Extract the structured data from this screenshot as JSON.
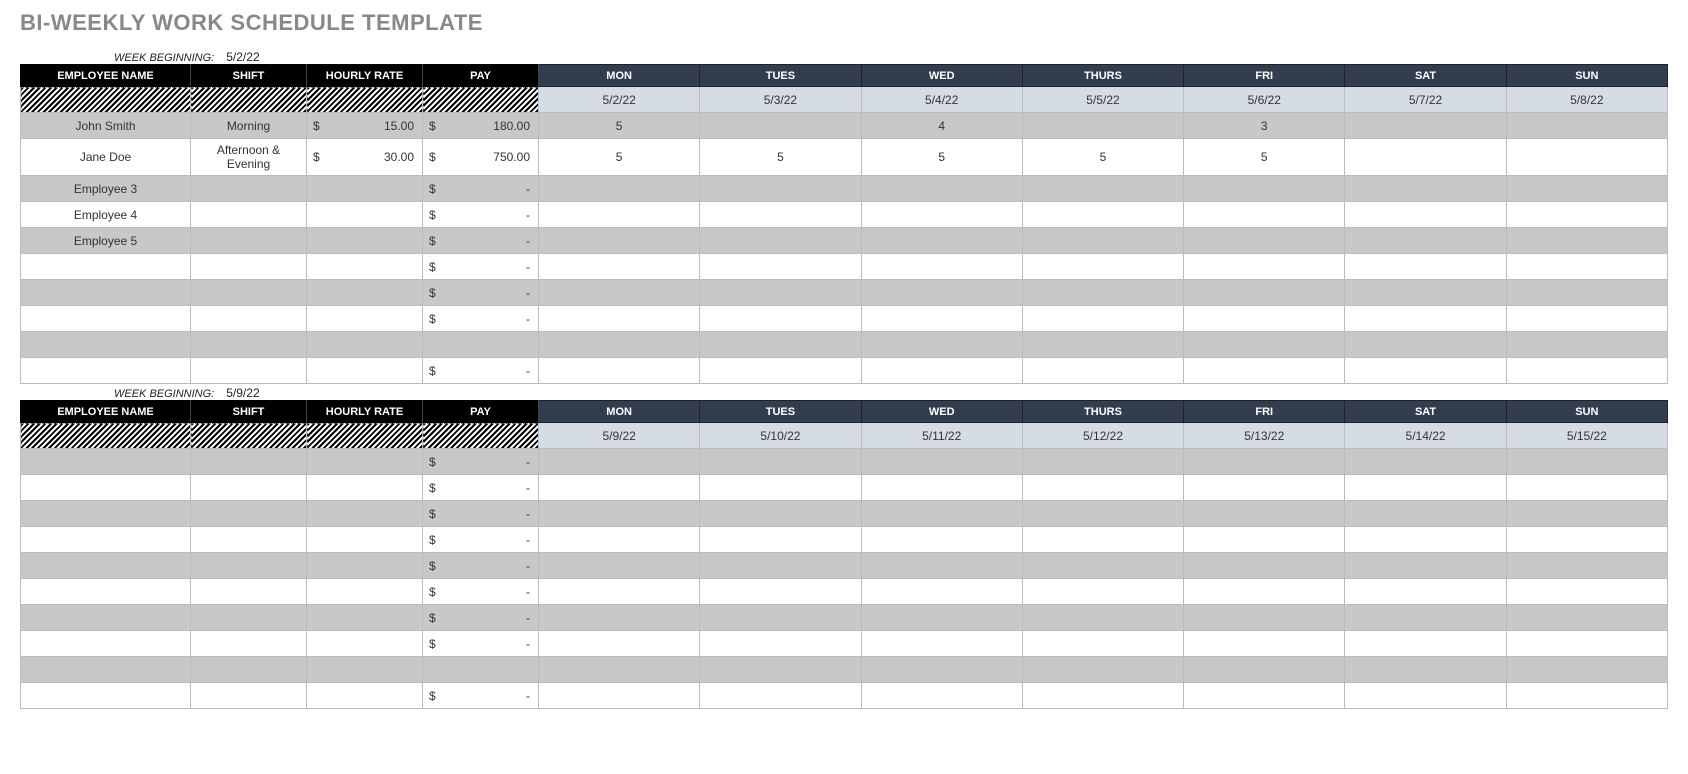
{
  "title": "BI-WEEKLY WORK SCHEDULE TEMPLATE",
  "week_beginning_label": "WEEK BEGINNING:",
  "columns": {
    "employee": "EMPLOYEE NAME",
    "shift": "SHIFT",
    "rate": "HOURLY RATE",
    "pay": "PAY",
    "days": [
      "MON",
      "TUES",
      "WED",
      "THURS",
      "FRI",
      "SAT",
      "SUN"
    ]
  },
  "weeks": [
    {
      "beginning": "5/2/22",
      "dates": [
        "5/2/22",
        "5/3/22",
        "5/4/22",
        "5/5/22",
        "5/6/22",
        "5/7/22",
        "5/8/22"
      ],
      "rows": [
        {
          "name": "John Smith",
          "shift": "Morning",
          "rate": "15.00",
          "pay": "180.00",
          "hours": [
            "5",
            "",
            "4",
            "",
            "3",
            "",
            ""
          ]
        },
        {
          "name": "Jane Doe",
          "shift": "Afternoon & Evening",
          "rate": "30.00",
          "pay": "750.00",
          "hours": [
            "5",
            "5",
            "5",
            "5",
            "5",
            "",
            ""
          ]
        },
        {
          "name": "Employee 3",
          "shift": "",
          "rate": "",
          "pay": "-",
          "hours": [
            "",
            "",
            "",
            "",
            "",
            "",
            ""
          ]
        },
        {
          "name": "Employee 4",
          "shift": "",
          "rate": "",
          "pay": "-",
          "hours": [
            "",
            "",
            "",
            "",
            "",
            "",
            ""
          ]
        },
        {
          "name": "Employee 5",
          "shift": "",
          "rate": "",
          "pay": "-",
          "hours": [
            "",
            "",
            "",
            "",
            "",
            "",
            ""
          ]
        },
        {
          "name": "",
          "shift": "",
          "rate": "",
          "pay": "-",
          "hours": [
            "",
            "",
            "",
            "",
            "",
            "",
            ""
          ]
        },
        {
          "name": "",
          "shift": "",
          "rate": "",
          "pay": "-",
          "hours": [
            "",
            "",
            "",
            "",
            "",
            "",
            ""
          ]
        },
        {
          "name": "",
          "shift": "",
          "rate": "",
          "pay": "-",
          "hours": [
            "",
            "",
            "",
            "",
            "",
            "",
            ""
          ]
        },
        {
          "name": "",
          "shift": "",
          "rate": "",
          "pay": "",
          "hours": [
            "",
            "",
            "",
            "",
            "",
            "",
            ""
          ]
        },
        {
          "name": "",
          "shift": "",
          "rate": "",
          "pay": "-",
          "hours": [
            "",
            "",
            "",
            "",
            "",
            "",
            ""
          ]
        }
      ]
    },
    {
      "beginning": "5/9/22",
      "dates": [
        "5/9/22",
        "5/10/22",
        "5/11/22",
        "5/12/22",
        "5/13/22",
        "5/14/22",
        "5/15/22"
      ],
      "rows": [
        {
          "name": "",
          "shift": "",
          "rate": "",
          "pay": "-",
          "hours": [
            "",
            "",
            "",
            "",
            "",
            "",
            ""
          ]
        },
        {
          "name": "",
          "shift": "",
          "rate": "",
          "pay": "-",
          "hours": [
            "",
            "",
            "",
            "",
            "",
            "",
            ""
          ]
        },
        {
          "name": "",
          "shift": "",
          "rate": "",
          "pay": "-",
          "hours": [
            "",
            "",
            "",
            "",
            "",
            "",
            ""
          ]
        },
        {
          "name": "",
          "shift": "",
          "rate": "",
          "pay": "-",
          "hours": [
            "",
            "",
            "",
            "",
            "",
            "",
            ""
          ]
        },
        {
          "name": "",
          "shift": "",
          "rate": "",
          "pay": "-",
          "hours": [
            "",
            "",
            "",
            "",
            "",
            "",
            ""
          ]
        },
        {
          "name": "",
          "shift": "",
          "rate": "",
          "pay": "-",
          "hours": [
            "",
            "",
            "",
            "",
            "",
            "",
            ""
          ]
        },
        {
          "name": "",
          "shift": "",
          "rate": "",
          "pay": "-",
          "hours": [
            "",
            "",
            "",
            "",
            "",
            "",
            ""
          ]
        },
        {
          "name": "",
          "shift": "",
          "rate": "",
          "pay": "-",
          "hours": [
            "",
            "",
            "",
            "",
            "",
            "",
            ""
          ]
        },
        {
          "name": "",
          "shift": "",
          "rate": "",
          "pay": "",
          "hours": [
            "",
            "",
            "",
            "",
            "",
            "",
            ""
          ]
        },
        {
          "name": "",
          "shift": "",
          "rate": "",
          "pay": "-",
          "hours": [
            "",
            "",
            "",
            "",
            "",
            "",
            ""
          ]
        }
      ]
    }
  ]
}
